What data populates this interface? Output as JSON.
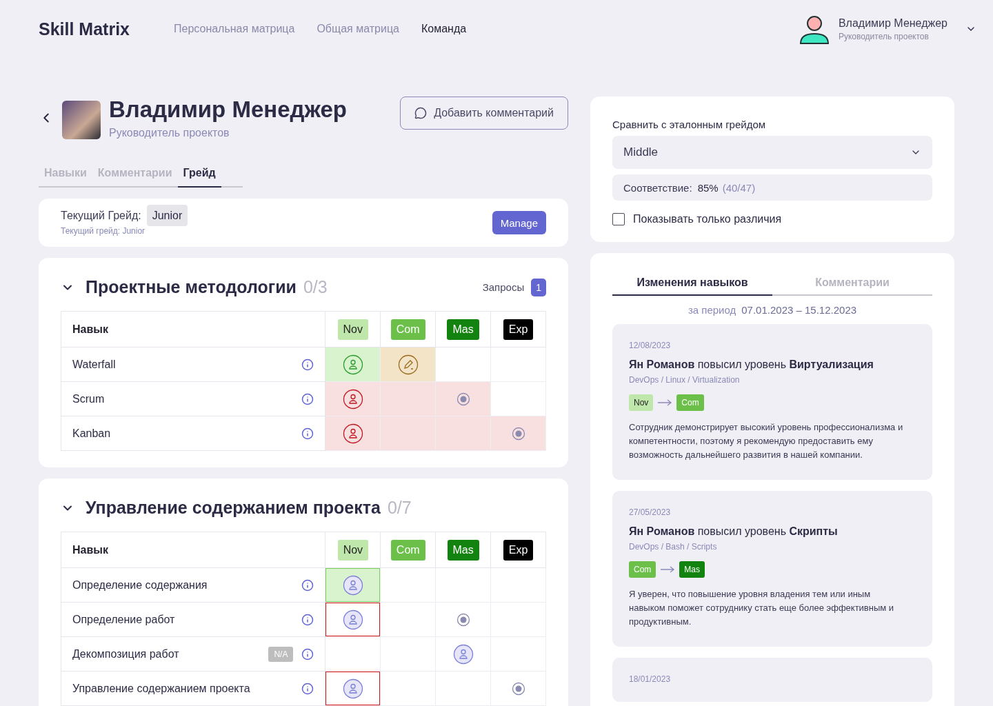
{
  "header": {
    "logo": "Skill Matrix",
    "nav": [
      {
        "label": "Персональная матрица",
        "selected": false
      },
      {
        "label": "Общая матрица",
        "selected": false
      },
      {
        "label": "Команда",
        "selected": true
      }
    ],
    "user": {
      "name": "Владимир Менеджер",
      "role": "Руководитель проектов"
    }
  },
  "profile": {
    "name": "Владимир Менеджер",
    "role": "Руководитель проектов",
    "comment_button": "Добавить комментарий"
  },
  "tabs": [
    {
      "label": "Навыки",
      "selected": false
    },
    {
      "label": "Комментарии",
      "selected": false
    },
    {
      "label": "Грейд",
      "selected": true
    }
  ],
  "grade": {
    "label": "Текущий Грейд:",
    "value": "Junior",
    "hint": "Текущий грейд: Junior",
    "button": "Manage"
  },
  "sections": [
    {
      "title": "Проектные методологии",
      "count": "0/3",
      "expanded": true,
      "requests": {
        "label": "Запросы",
        "count": "1"
      },
      "column_header": "Навык",
      "levels": [
        {
          "label": "Nov",
          "color": "#bfe6ab"
        },
        {
          "label": "Com",
          "color": "#6cc04a"
        },
        {
          "label": "Mas",
          "color": "#13830f"
        },
        {
          "label": "Exp",
          "color": "#000000"
        }
      ],
      "rows": [
        {
          "skill": "Waterfall",
          "cells": [
            {
              "kind": "approved",
              "color": "#d8f3cd",
              "highlighted": false,
              "flagged": false
            },
            {
              "kind": "edit",
              "color": "#f3e4c8",
              "highlighted": false,
              "flagged": false
            },
            {
              "kind": "empty",
              "color": "#ffffff",
              "highlighted": false,
              "flagged": false
            },
            {
              "kind": "empty",
              "color": "#ffffff",
              "highlighted": false,
              "flagged": false
            }
          ]
        },
        {
          "skill": "Scrum",
          "cells": [
            {
              "kind": "rejected",
              "color": "#f8e0e1",
              "highlighted": false,
              "flagged": false
            },
            {
              "kind": "empty",
              "color": "#f8e0e1",
              "highlighted": false,
              "flagged": false
            },
            {
              "kind": "target",
              "color": "#f8e0e1",
              "highlighted": false,
              "flagged": false
            },
            {
              "kind": "empty",
              "color": "#ffffff",
              "highlighted": false,
              "flagged": false
            }
          ]
        },
        {
          "skill": "Kanban",
          "cells": [
            {
              "kind": "rejected",
              "color": "#f8e0e1",
              "highlighted": false,
              "flagged": false
            },
            {
              "kind": "empty",
              "color": "#f8e0e1",
              "highlighted": false,
              "flagged": false
            },
            {
              "kind": "empty",
              "color": "#f8e0e1",
              "highlighted": false,
              "flagged": false
            },
            {
              "kind": "target",
              "color": "#f8e0e1",
              "highlighted": false,
              "flagged": false
            }
          ]
        }
      ]
    },
    {
      "title": "Управление содержанием проекта",
      "count": "0/7",
      "expanded": true,
      "column_header": "Навык",
      "levels": [
        {
          "label": "Nov",
          "color": "#bfe6ab"
        },
        {
          "label": "Com",
          "color": "#6cc04a"
        },
        {
          "label": "Mas",
          "color": "#13830f"
        },
        {
          "label": "Exp",
          "color": "#000000"
        }
      ],
      "rows": [
        {
          "skill": "Определение содержания",
          "cells": [
            {
              "kind": "person",
              "color": "#d8f3cd",
              "highlighted": true,
              "flagged": false
            },
            {
              "kind": "empty",
              "color": "#ffffff",
              "highlighted": false,
              "flagged": false
            },
            {
              "kind": "empty",
              "color": "#ffffff",
              "highlighted": false,
              "flagged": false
            },
            {
              "kind": "empty",
              "color": "#ffffff",
              "highlighted": false,
              "flagged": false
            }
          ]
        },
        {
          "skill": "Определение работ",
          "cells": [
            {
              "kind": "person",
              "color": "#ffffff",
              "highlighted": false,
              "flagged": true
            },
            {
              "kind": "empty",
              "color": "#ffffff",
              "highlighted": false,
              "flagged": false
            },
            {
              "kind": "target",
              "color": "#ffffff",
              "highlighted": false,
              "flagged": false
            },
            {
              "kind": "empty",
              "color": "#ffffff",
              "highlighted": false,
              "flagged": false
            }
          ]
        },
        {
          "skill": "Декомпозиция работ",
          "badge": "N/A",
          "cells": [
            {
              "kind": "empty",
              "color": "#ffffff",
              "highlighted": false,
              "flagged": false
            },
            {
              "kind": "empty",
              "color": "#ffffff",
              "highlighted": false,
              "flagged": false
            },
            {
              "kind": "person",
              "color": "#ffffff",
              "highlighted": false,
              "flagged": false
            },
            {
              "kind": "empty",
              "color": "#ffffff",
              "highlighted": false,
              "flagged": false
            }
          ]
        },
        {
          "skill": "Управление содержанием проекта",
          "cells": [
            {
              "kind": "person",
              "color": "#ffffff",
              "highlighted": false,
              "flagged": true
            },
            {
              "kind": "empty",
              "color": "#ffffff",
              "highlighted": false,
              "flagged": false
            },
            {
              "kind": "empty",
              "color": "#ffffff",
              "highlighted": false,
              "flagged": false
            },
            {
              "kind": "target",
              "color": "#ffffff",
              "highlighted": false,
              "flagged": false
            }
          ]
        }
      ]
    }
  ],
  "compare": {
    "label": "Сравнить с эталонным грейдом",
    "select": "Middle",
    "match_label": "Соответствие:",
    "match_percent": "85%",
    "match_ratio": "(40/47)",
    "checkbox": {
      "label": "Показывать только различия",
      "checked": false
    }
  },
  "history": {
    "tabs": [
      {
        "label": "Изменения навыков",
        "selected": true
      },
      {
        "label": "Комментарии",
        "selected": false
      }
    ],
    "period_label": "за период",
    "period": "07.01.2023 – 15.12.2023",
    "changes": [
      {
        "date": "12/08/2023",
        "title": "**Ян Романов** повысил уровень **Виртуализация**",
        "path": "DevOps / Linux / Virtualization",
        "from": {
          "label": "Nov",
          "color": "#bfe6ab"
        },
        "to": {
          "label": "Com",
          "color": "#6cc04a"
        },
        "text": "Сотрудник демонстрирует высокий уровень профессионализма и компетентности, поэтому я рекомендую предоставить ему возможность дальнейшего развития в нашей компании."
      },
      {
        "date": "27/05/2023",
        "title": "**Ян Романов** повысил уровень **Скрипты**",
        "path": "DevOps / Bash / Scripts",
        "from": {
          "label": "Com",
          "color": "#6cc04a"
        },
        "to": {
          "label": "Mas",
          "color": "#13830f"
        },
        "text": "Я уверен, что повышение уровня владения тем или иным навыком поможет сотруднику стать еще более эффективным и продуктивным."
      },
      {
        "date": "18/01/2023"
      }
    ]
  }
}
